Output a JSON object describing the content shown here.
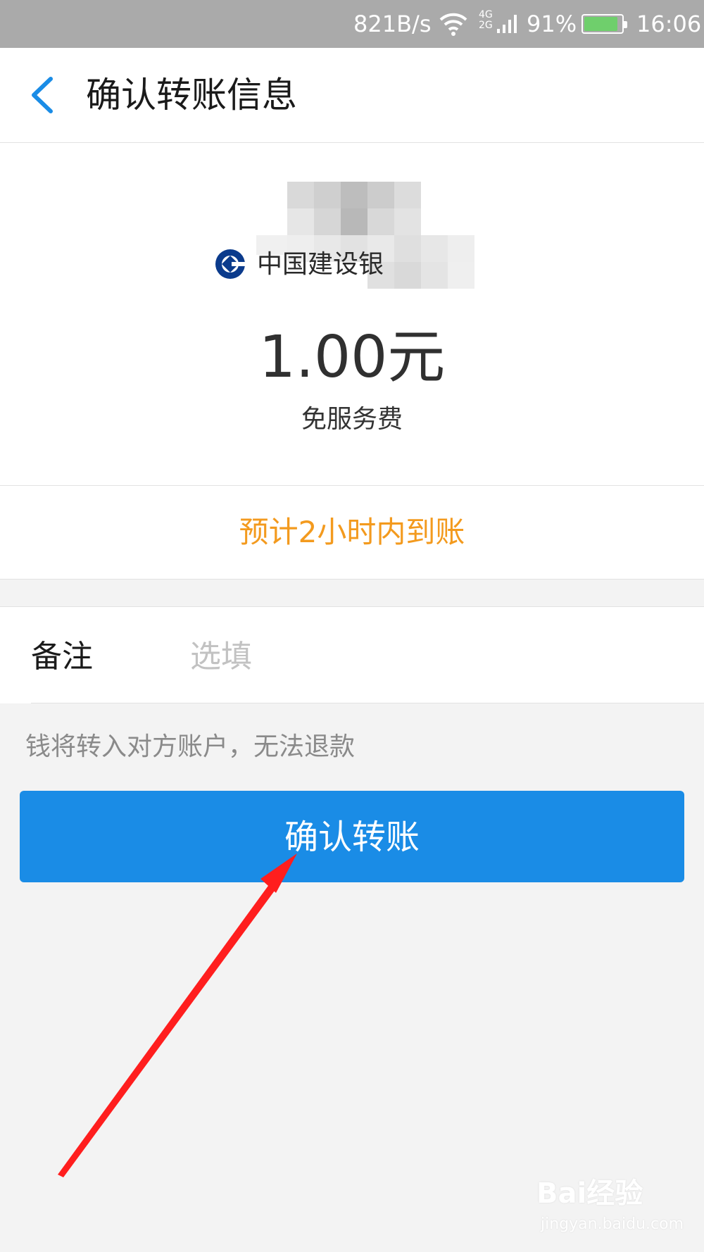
{
  "status_bar": {
    "speed": "821B/s",
    "network": "4G\n2G",
    "battery_percent": "91%",
    "battery_level": 0.91,
    "time": "16:06",
    "icons": [
      "wifi-icon",
      "signal-icon",
      "battery-icon"
    ]
  },
  "header": {
    "title": "确认转账信息",
    "back_icon": "chevron-left-icon",
    "accent_color": "#1a8ce6"
  },
  "recipient": {
    "bank_name": "中国建设银",
    "bank_logo": "ccb-logo-icon",
    "amount": "1.00元",
    "fee_note": "免服务费"
  },
  "arrival": {
    "text": "预计2小时内到账",
    "color": "#f39a1e"
  },
  "remark": {
    "label": "备注",
    "placeholder": "选填",
    "value": ""
  },
  "notice": "钱将转入对方账户，无法退款",
  "confirm_button": {
    "label": "确认转账",
    "color": "#1a8ce6"
  },
  "annotation": {
    "arrow_color": "#ff1e1e"
  },
  "watermark": {
    "main": "Bai经验",
    "sub": "jingyan.baidu.com"
  }
}
